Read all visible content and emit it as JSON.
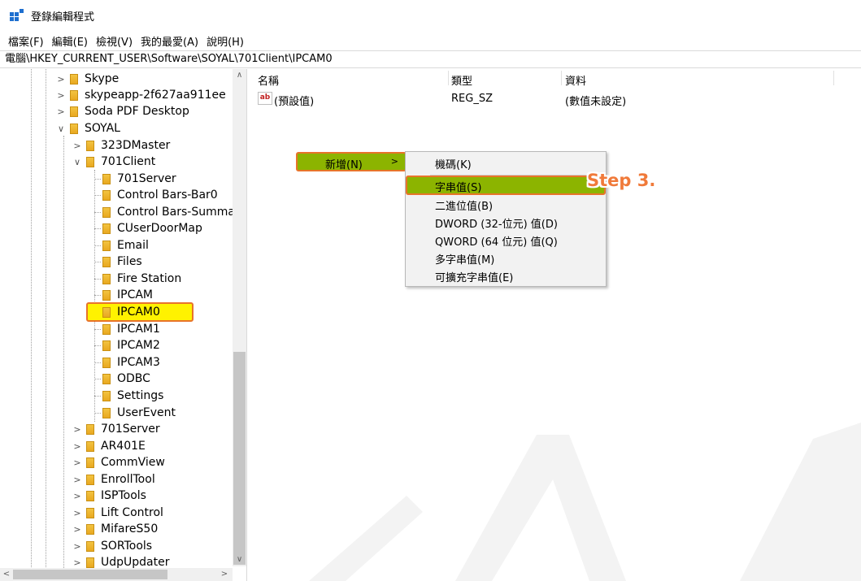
{
  "window": {
    "title": "登錄編輯程式"
  },
  "menu": [
    "檔案(F)",
    "編輯(E)",
    "檢視(V)",
    "我的最愛(A)",
    "說明(H)"
  ],
  "address": "電腦\\HKEY_CURRENT_USER\\Software\\SOYAL\\701Client\\IPCAM0",
  "tree": {
    "items": [
      {
        "label": "Skype",
        "expanded": false
      },
      {
        "label": "skypeapp-2f627aa911ee",
        "expanded": false
      },
      {
        "label": "Soda PDF Desktop",
        "expanded": false
      },
      {
        "label": "SOYAL",
        "expanded": true
      },
      {
        "label": "323DMaster",
        "expanded": false
      },
      {
        "label": "701Client",
        "expanded": true
      },
      {
        "label": "701Server"
      },
      {
        "label": "Control Bars-Bar0"
      },
      {
        "label": "Control Bars-Summar"
      },
      {
        "label": "CUserDoorMap"
      },
      {
        "label": "Email"
      },
      {
        "label": "Files"
      },
      {
        "label": "Fire Station"
      },
      {
        "label": "IPCAM"
      },
      {
        "label": "IPCAM0",
        "selected": true
      },
      {
        "label": "IPCAM1"
      },
      {
        "label": "IPCAM2"
      },
      {
        "label": "IPCAM3"
      },
      {
        "label": "ODBC"
      },
      {
        "label": "Settings"
      },
      {
        "label": "UserEvent"
      },
      {
        "label": "701Server",
        "expanded": false
      },
      {
        "label": "AR401E",
        "expanded": false
      },
      {
        "label": "CommView",
        "expanded": false
      },
      {
        "label": "EnrollTool",
        "expanded": false
      },
      {
        "label": "ISPTools",
        "expanded": false
      },
      {
        "label": "Lift Control",
        "expanded": false
      },
      {
        "label": "MifareS50",
        "expanded": false
      },
      {
        "label": "SORTools",
        "expanded": false
      },
      {
        "label": "UdpUpdater",
        "expanded": false
      }
    ]
  },
  "list": {
    "columns": [
      "名稱",
      "類型",
      "資料"
    ],
    "rows": [
      {
        "name": "(預設值)",
        "type": "REG_SZ",
        "data": "(數值未設定)"
      }
    ]
  },
  "context_menu": {
    "parent_item": "新增(N)",
    "submenu": [
      "機碼(K)",
      "字串值(S)",
      "二進位值(B)",
      "DWORD (32-位元) 值(D)",
      "QWORD (64 位元) 值(Q)",
      "多字串值(M)",
      "可擴充字串值(E)"
    ],
    "highlighted": "字串值(S)"
  },
  "annotation": {
    "step": "Step 3."
  },
  "colors": {
    "highlight_green": "#8cb400",
    "callout_orange": "#e8742a",
    "selected_yellow": "#fff200",
    "icon_blue": "#1e6fcf"
  }
}
